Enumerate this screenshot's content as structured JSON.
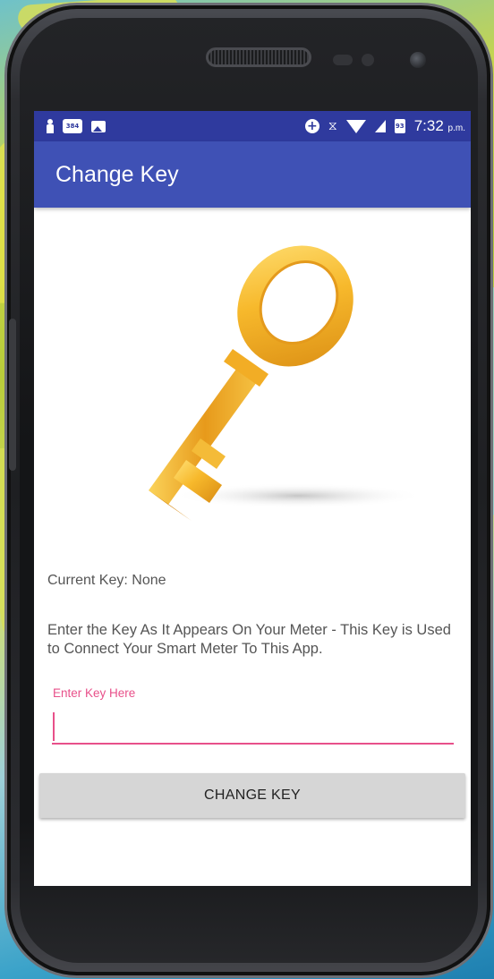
{
  "status_bar": {
    "notification_badge": "384",
    "battery_level": "93",
    "time": "7:32",
    "time_suffix": "p.m."
  },
  "app_bar": {
    "title": "Change Key"
  },
  "content": {
    "current_key": "Current Key: None",
    "instructions": "Enter the Key As It Appears On Your Meter - This Key is Used to Connect Your Smart Meter To This App.",
    "input_label": "Enter Key Here",
    "input_value": "",
    "button_label": "CHANGE KEY"
  },
  "colors": {
    "status_bar": "#2f3a9e",
    "app_bar": "#3f51b5",
    "accent": "#e8508a",
    "button": "#d6d6d6"
  },
  "icons": {
    "hero_image": "golden-key",
    "status_left": [
      "person-icon",
      "notification-badge-icon",
      "image-icon"
    ],
    "status_right": [
      "plus-circle-icon",
      "hourglass-icon",
      "wifi-icon",
      "signal-icon",
      "battery-icon"
    ]
  }
}
